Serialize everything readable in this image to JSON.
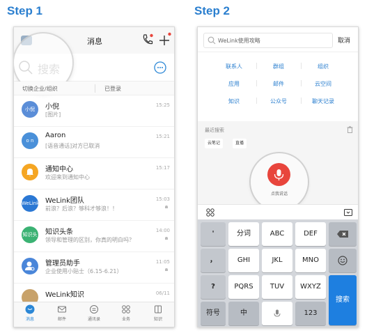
{
  "steps": {
    "step1": "Step 1",
    "step2": "Step 2"
  },
  "phone1": {
    "title": "消息",
    "search_placeholder": "搜索",
    "switch_org": "切换企业/组织",
    "logged_in": "已登录",
    "chats": [
      {
        "avatar_text": "小倪",
        "avatar_color": "#5b8ed8",
        "name": "小倪",
        "preview": "[图片]",
        "time": "15:25",
        "muted": false
      },
      {
        "avatar_text": "o n",
        "avatar_color": "#4a90d9",
        "name": "Aaron",
        "preview": "[语音通话]对方已取消",
        "time": "15:21",
        "muted": false
      },
      {
        "avatar_text": "",
        "avatar_color": "#f5a623",
        "name": "通知中心",
        "preview": "欢迎来到通知中心",
        "time": "15:17",
        "muted": false
      },
      {
        "avatar_text": "WeLink",
        "avatar_color": "#2b78d4",
        "name": "WeLink团队",
        "preview": "前浪？后浪？够科才够浪！！",
        "time": "15:03",
        "muted": true
      },
      {
        "avatar_text": "知识头条",
        "avatar_color": "#3bb273",
        "name": "知识头条",
        "preview": "领导和管理的区别，你真的明白吗？",
        "time": "14:00",
        "muted": true
      },
      {
        "avatar_text": "",
        "avatar_color": "#4a86d9",
        "name": "管理员助手",
        "preview": "企业使用小贴士（6.15-6.21）",
        "time": "11:05",
        "muted": true
      },
      {
        "avatar_text": "",
        "avatar_color": "#c8a26a",
        "name": "WeLink知识",
        "preview": "",
        "time": "06/11",
        "muted": false
      }
    ],
    "tabs": [
      "消息",
      "邮件",
      "通讯录",
      "业务",
      "知识"
    ],
    "active_tab": 0
  },
  "phone2": {
    "search_placeholder": "WeLink使用攻略",
    "cancel": "取消",
    "categories": [
      "联系人",
      "群组",
      "组织",
      "应用",
      "邮件",
      "云空间",
      "知识",
      "公众号",
      "聊天记录"
    ],
    "recent_label": "最近搜索",
    "recent_chips": [
      "云笔记",
      "直播"
    ],
    "voice_label": "点我说话",
    "keyboard": {
      "punct": [
        "'",
        "，",
        "?",
        "!"
      ],
      "row1": [
        "分词",
        "ABC",
        "DEF"
      ],
      "row2": [
        "GHI",
        "JKL",
        "MNO"
      ],
      "row3": [
        "PQRS",
        "TUV",
        "WXYZ"
      ],
      "symbol": "符号",
      "lang": "中",
      "num": "123",
      "search": "搜索"
    }
  },
  "colors": {
    "accent": "#2b7fcf",
    "voice": "#e8453c",
    "key_blue": "#1e7fe0"
  }
}
